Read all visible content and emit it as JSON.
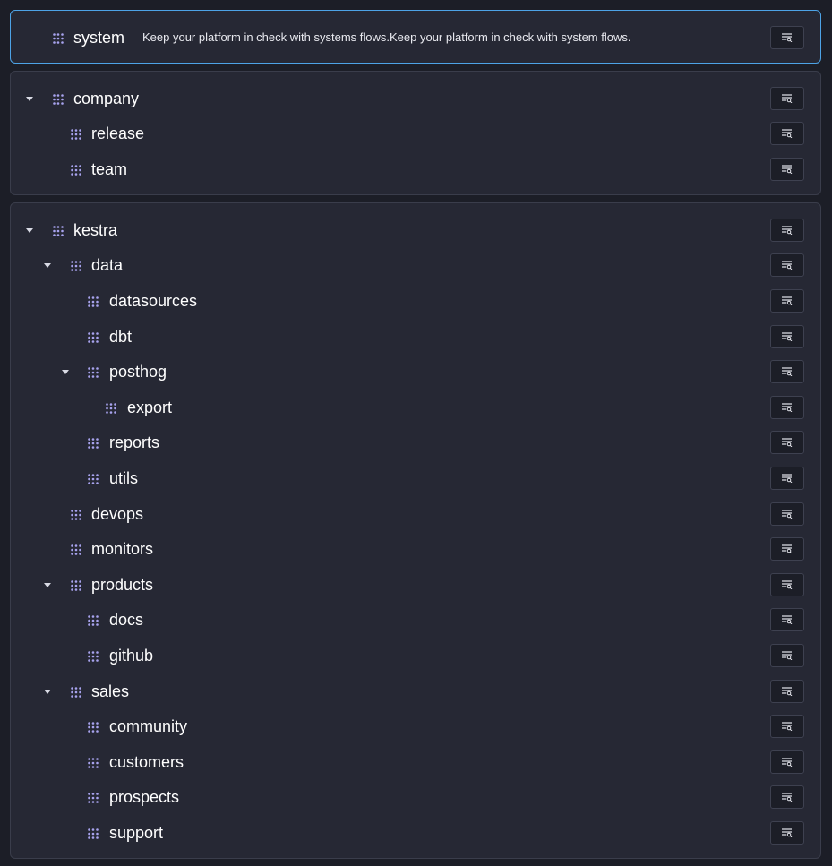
{
  "system": {
    "label": "system",
    "description": "Keep your platform in check with systems flows.Keep your platform in check with system flows."
  },
  "company": {
    "label": "company",
    "children": [
      {
        "label": "release"
      },
      {
        "label": "team"
      }
    ]
  },
  "kestra": {
    "label": "kestra",
    "data": {
      "label": "data",
      "datasources": "datasources",
      "dbt": "dbt",
      "posthog": {
        "label": "posthog",
        "export": "export"
      },
      "reports": "reports",
      "utils": "utils"
    },
    "devops": "devops",
    "monitors": "monitors",
    "products": {
      "label": "products",
      "docs": "docs",
      "github": "github"
    },
    "sales": {
      "label": "sales",
      "community": "community",
      "customers": "customers",
      "prospects": "prospects",
      "support": "support"
    }
  },
  "icons": {
    "grip": "drag-grip-icon",
    "caret": "caret-down-icon",
    "filter_button": "filter-list-search-icon"
  },
  "colors": {
    "background": "#1c1e27",
    "card": "#262834",
    "selected_border": "#4da3e6",
    "grip": "#a8a3ee"
  }
}
